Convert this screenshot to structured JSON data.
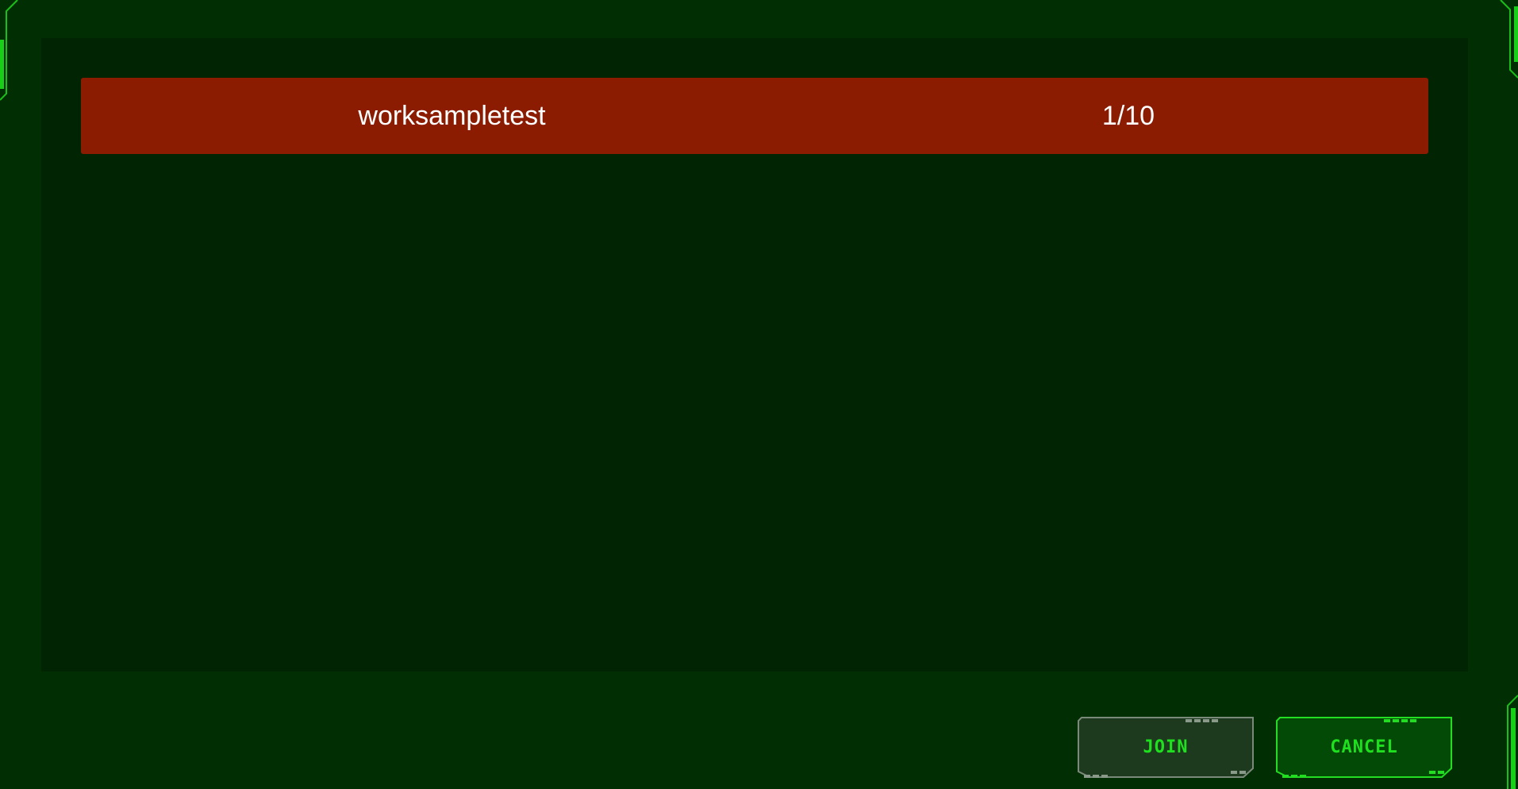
{
  "rooms": [
    {
      "name": "worksampletest",
      "players": "1/10"
    }
  ],
  "buttons": {
    "join_label": "JOIN",
    "cancel_label": "CANCEL"
  },
  "colors": {
    "background": "#022e03",
    "panel": "#012402",
    "selected_row": "#8b1c02",
    "accent_green": "#1fe01f"
  }
}
